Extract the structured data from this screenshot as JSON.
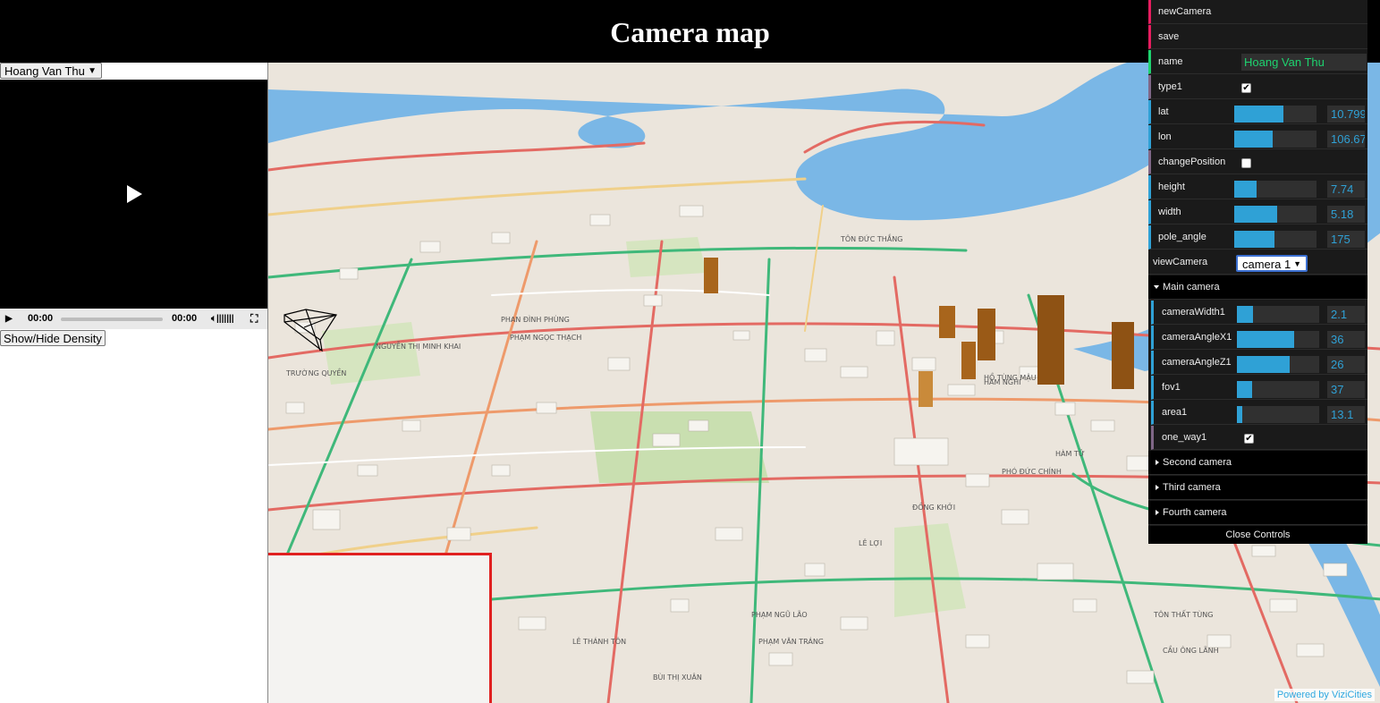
{
  "header": {
    "title": "Camera map"
  },
  "left_panel": {
    "camera_select": "Hoang Van Thu",
    "video": {
      "current_time": "00:00",
      "duration": "00:00"
    },
    "density_button": "Show/Hide Density"
  },
  "map": {
    "attribution": "Powered by ViziCities",
    "labels": [
      "PHẠM VĂN TRÁNG",
      "LÊ THÁNH TÔN",
      "HÀM NGHI",
      "TÔN ĐỨC THẮNG",
      "PHAN ĐÌNH PHÙNG",
      "TRƯỜNG QUYỀN",
      "PHẠM NGỌC THẠCH",
      "NGUYỄN THỊ MINH KHAI",
      "HỒ TÙNG MẬU",
      "CẦU ÔNG LÃNH",
      "HÀM TỬ",
      "ĐỒNG KHỞI",
      "PHÓ ĐỨC CHÍNH",
      "LÊ LỢI",
      "PHẠM NGŨ LÃO",
      "BÙI THỊ XUÂN",
      "TÔN THẤT TÙNG"
    ]
  },
  "gui": {
    "new_camera": "newCamera",
    "save": "save",
    "name_label": "name",
    "name_value": "Hoang Van Thu",
    "type1_label": "type1",
    "type1_checked": true,
    "lat_label": "lat",
    "lat_value": "10.799",
    "lat_fill": 0.6,
    "lon_label": "lon",
    "lon_value": "106.67",
    "lon_fill": 0.47,
    "change_position_label": "changePosition",
    "change_position_checked": false,
    "height_label": "height",
    "height_value": "7.74",
    "height_fill": 0.27,
    "width_label": "width",
    "width_value": "5.18",
    "width_fill": 0.52,
    "pole_angle_label": "pole_angle",
    "pole_angle_value": "175",
    "pole_angle_fill": 0.49,
    "view_camera_label": "viewCamera",
    "view_camera_value": "camera 1",
    "main_camera_folder": "Main camera",
    "camera_width_label": "cameraWidth1",
    "camera_width_value": "2.1",
    "camera_width_fill": 0.2,
    "camera_angle_x_label": "cameraAngleX1",
    "camera_angle_x_value": "36",
    "camera_angle_x_fill": 0.7,
    "camera_angle_z_label": "cameraAngleZ1",
    "camera_angle_z_value": "26",
    "camera_angle_z_fill": 0.64,
    "fov_label": "fov1",
    "fov_value": "37",
    "fov_fill": 0.19,
    "area_label": "area1",
    "area_value": "13.1",
    "area_fill": 0.06,
    "one_way_label": "one_way1",
    "one_way_checked": true,
    "second_camera_folder": "Second camera",
    "third_camera_folder": "Third camera",
    "fourth_camera_folder": "Fourth camera",
    "close_controls": "Close Controls",
    "accent_color": "#2fa1d6",
    "string_color": "#1ed36f",
    "function_color": "#e61d5f"
  }
}
